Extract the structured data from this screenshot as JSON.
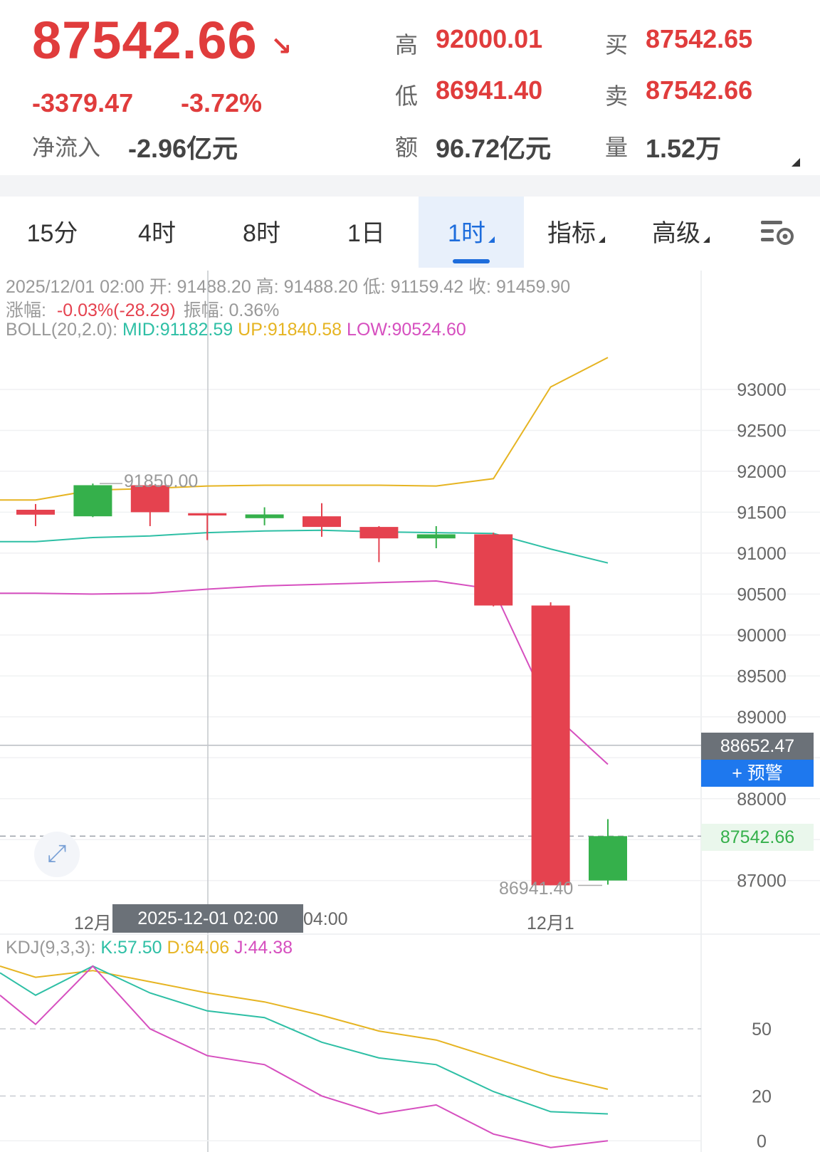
{
  "header": {
    "price": "87542.66",
    "arrow": "↘",
    "change": "-3379.47",
    "change_pct": "-3.72%",
    "net_inflow_label": "净流入",
    "net_inflow_value": "-2.96亿元",
    "high_label": "高",
    "high_value": "92000.01",
    "low_label": "低",
    "low_value": "86941.40",
    "amount_label": "额",
    "amount_value": "96.72亿元",
    "bid_label": "买",
    "bid_value": "87542.65",
    "ask_label": "卖",
    "ask_value": "87542.66",
    "volume_label": "量",
    "volume_value": "1.52万"
  },
  "tabs": [
    {
      "label": "15分",
      "active": false
    },
    {
      "label": "4时",
      "active": false
    },
    {
      "label": "8时",
      "active": false
    },
    {
      "label": "1日",
      "active": false
    },
    {
      "label": "1时",
      "active": true
    },
    {
      "label": "指标",
      "active": false
    },
    {
      "label": "高级",
      "active": false
    }
  ],
  "settings_icon": "chart-settings-icon",
  "crosshair_info": {
    "line1": "2025/12/01 02:00 开: 91488.20 高: 91488.20 低: 91159.42 收: 91459.90",
    "change_label": "涨幅:",
    "change_value": "-0.03%(-28.29)",
    "amplitude": "振幅: 0.36%",
    "boll_label": "BOLL(20,2.0):",
    "boll_mid": "MID:91182.59",
    "boll_up": "UP:91840.58",
    "boll_low": "LOW:90524.60"
  },
  "kdj_info": {
    "label": "KDJ(9,3,3):",
    "k": "K:57.50",
    "d": "D:64.06",
    "j": "J:44.38"
  },
  "price_axis_labels": [
    "93000",
    "92500",
    "92000",
    "91500",
    "91000",
    "90500",
    "90000",
    "89500",
    "89000",
    "88000",
    "87000"
  ],
  "kdj_axis_labels": [
    "50",
    "20",
    "0"
  ],
  "crosshair_price": "88652.47",
  "alert_button": "+ 预警",
  "current_price_tag": "87542.66",
  "high_marker": "91850.00",
  "low_marker": "86941.40",
  "time_axis": {
    "left": "12月",
    "mid": "04:00",
    "right": "12月1"
  },
  "crosshair_time": "2025-12-01 02:00",
  "colors": {
    "up": "#35b04b",
    "down": "#e5424f",
    "boll_mid": "#2ebfa5",
    "boll_up": "#e6b422",
    "boll_low": "#d64fbf",
    "kdj_k": "#2ebfa5",
    "kdj_d": "#e6b422",
    "kdj_j": "#d64fbf",
    "accent": "#1e6ddc"
  },
  "chart_data": {
    "type": "candlestick",
    "interval": "1时",
    "candles": [
      {
        "open": 91530,
        "close": 91470,
        "high": 91600,
        "low": 91330,
        "dir": "down"
      },
      {
        "open": 91450,
        "close": 91830,
        "high": 91850,
        "low": 91440,
        "dir": "up"
      },
      {
        "open": 91830,
        "close": 91500,
        "high": 91840,
        "low": 91330,
        "dir": "down"
      },
      {
        "open": 91488.2,
        "close": 91459.9,
        "high": 91488.2,
        "low": 91159.42,
        "dir": "down"
      },
      {
        "open": 91440,
        "close": 91460,
        "high": 91560,
        "low": 91340,
        "dir": "up"
      },
      {
        "open": 91450,
        "close": 91320,
        "high": 91610,
        "low": 91200,
        "dir": "down"
      },
      {
        "open": 91320,
        "close": 91180,
        "high": 91330,
        "low": 90890,
        "dir": "down"
      },
      {
        "open": 91180,
        "close": 91230,
        "high": 91330,
        "low": 91060,
        "dir": "up"
      },
      {
        "open": 91230,
        "close": 90360,
        "high": 91250,
        "low": 90350,
        "dir": "down"
      },
      {
        "open": 90360,
        "close": 86941.4,
        "high": 90400,
        "low": 86941.4,
        "dir": "down"
      },
      {
        "open": 87000,
        "close": 87542.66,
        "high": 87750,
        "low": 86950,
        "dir": "up"
      }
    ],
    "boll_up": [
      91650,
      91770,
      91790,
      91820,
      91830,
      91830,
      91830,
      91820,
      91910,
      93030,
      93390
    ],
    "boll_mid": [
      91140,
      91190,
      91210,
      91250,
      91270,
      91280,
      91260,
      91250,
      91240,
      91050,
      90880
    ],
    "boll_low": [
      90510,
      90500,
      90510,
      90560,
      90600,
      90620,
      90640,
      90660,
      90560,
      89060,
      88420
    ],
    "kdj_k": [
      75,
      65,
      78,
      66,
      58,
      55,
      44,
      37,
      34,
      22,
      13,
      12
    ],
    "kdj_d": [
      78,
      73,
      76,
      71,
      66,
      62,
      56,
      49,
      45,
      37,
      29,
      23
    ],
    "kdj_j": [
      65,
      52,
      78,
      50,
      38,
      34,
      20,
      12,
      16,
      3,
      -3,
      0
    ],
    "price_range": [
      86780,
      93600
    ],
    "kdj_range": [
      -5,
      84
    ]
  }
}
